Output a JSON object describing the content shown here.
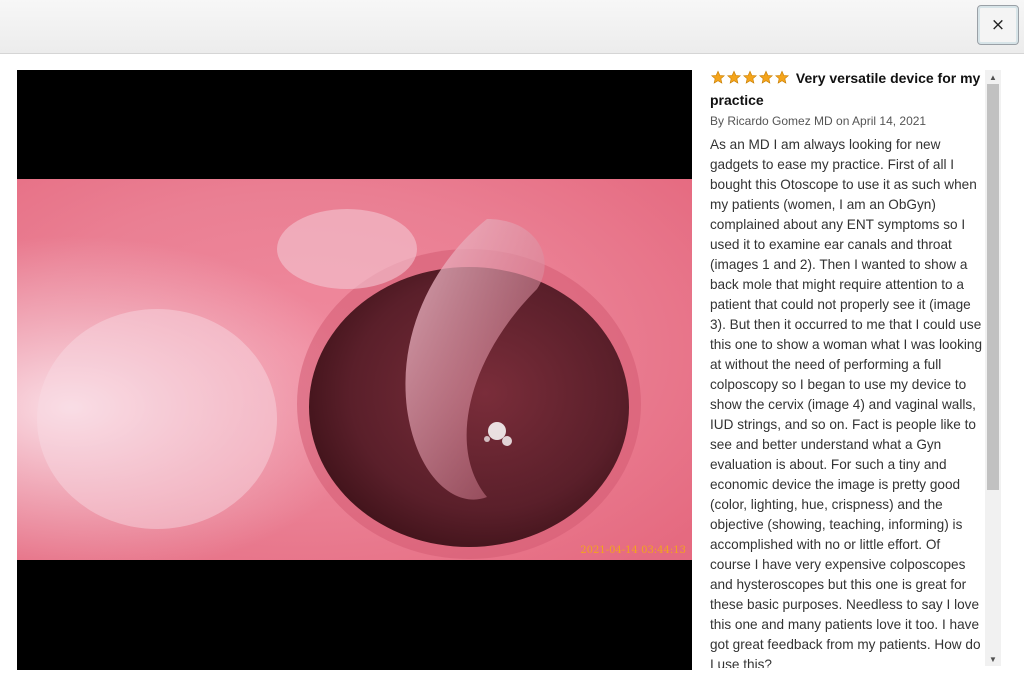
{
  "dialog": {
    "close_label": "×"
  },
  "image": {
    "timestamp": "2021-04-14 03:44:13",
    "colors": {
      "background": "#000000",
      "tissue_light": "#f6d2dc",
      "tissue": "#ea7f93",
      "cavity": "#5a1f2a",
      "highlight": "#ffffff"
    }
  },
  "review": {
    "rating": 5,
    "star_color": "#f4a41b",
    "title": "Very versatile device for my practice",
    "byline": "By Ricardo Gomez MD on April 14, 2021",
    "body": "As an MD I am always looking for new gadgets to ease my practice. First of all I bought this Otoscope to use it as such when my patients (women, I am an ObGyn) complained about any ENT symptoms so I used it to examine ear canals and throat (images 1 and 2). Then I wanted to show a back mole that might require attention to a patient that could not properly see it (image 3). But then it occurred to me that I could use this one to show a woman what I was looking at without the need of performing a full colposcopy so I began to use my device to show the cervix (image 4) and vaginal walls, IUD strings, and so on. Fact is people like to see and better understand what a Gyn evaluation is about. For such a tiny and economic device the image is pretty good (color, lighting, hue, crispness) and the objective (showing, teaching, informing) is accomplished with no or little effort. Of course I have very expensive colposcopes and hysteroscopes but this one is great for these basic purposes. Needless to say I love this one and many patients love it too. I have got great feedback from my patients. How do I use this?"
  },
  "scrollbar": {
    "up_icon": "▲",
    "down_icon": "▼"
  }
}
